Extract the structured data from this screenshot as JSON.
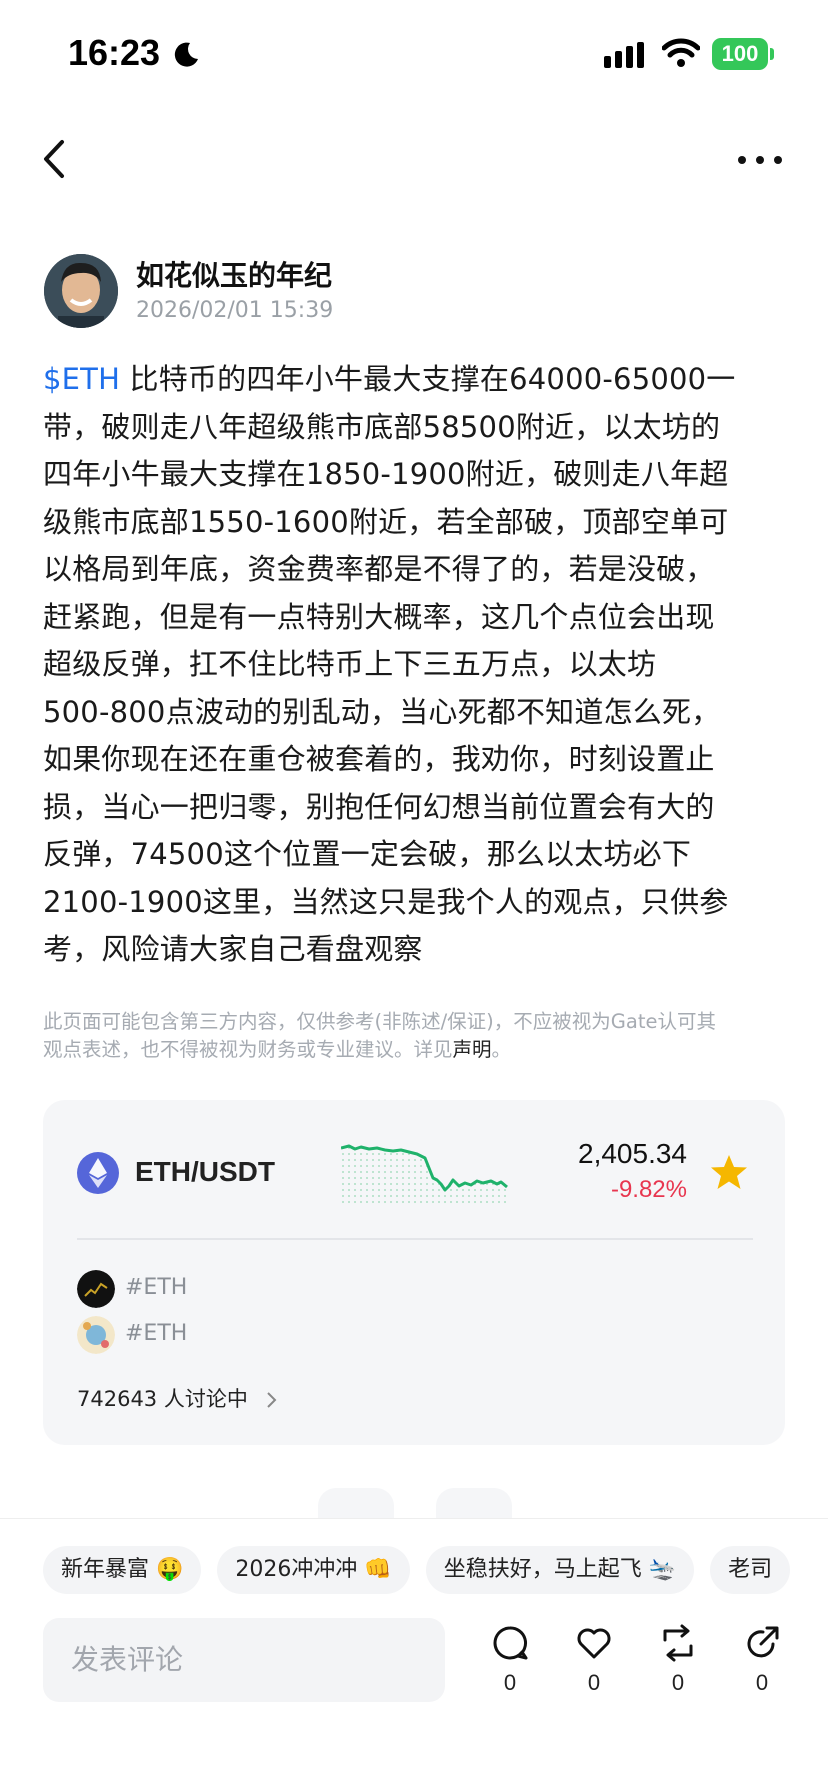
{
  "status_bar": {
    "time": "16:23",
    "battery": "100"
  },
  "author": {
    "name": "如花似玉的年纪",
    "post_time": "2026/02/01 15:39"
  },
  "post": {
    "tag": "$ETH",
    "lines": [
      " 比特币的四年小牛最大支撑在64000-65000一",
      "带，破则走八年超级熊市底部58500附近，以太坊的",
      "四年小牛最大支撑在1850-1900附近，破则走八年超",
      "级熊市底部1550-1600附近，若全部破，顶部空单可",
      "以格局到年底，资金费率都是不得了的，若是没破，",
      "赶紧跑，但是有一点特别大概率，这几个点位会出现",
      "超级反弹，扛不住比特币上下三五万点，以太坊",
      "500-800点波动的别乱动，当心死都不知道怎么死，",
      "如果你现在还在重仓被套着的，我劝你，时刻设置止",
      "损，当心一把归零，别抱任何幻想当前位置会有大的",
      "反弹，74500这个位置一定会破，那么以太坊必下",
      "2100-1900这里，当然这只是我个人的观点，只供参",
      "考，风险请大家自己看盘观察"
    ]
  },
  "disclaimer": {
    "line1": "此页面可能包含第三方内容，仅供参考(非陈述/保证)，不应被视为Gate认可其",
    "line2": "观点表述，也不得被视为财务或专业建议。详见",
    "link": "声明",
    "end": "。"
  },
  "market_card": {
    "pair": "ETH/USDT",
    "price": "2,405.34",
    "change": "-9.82%",
    "topics": [
      "#ETH",
      "#ETH"
    ],
    "discussion": "742643 人讨论中"
  },
  "chips": [
    "新年暴富 🤑",
    "2026冲冲冲 👊",
    "坐稳扶好，马上起飞 🛬",
    "老司"
  ],
  "comment": {
    "placeholder": "发表评论"
  },
  "actions": {
    "comments": "0",
    "likes": "0",
    "reposts": "0",
    "shares": "0"
  },
  "colors": {
    "accent_blue": "#1f6feb",
    "negative_red": "#e8364f",
    "chart_green": "#1fb26b",
    "star_yellow": "#f5b700"
  },
  "icons": [
    "moon-icon",
    "signal-icon",
    "wifi-icon",
    "battery-icon",
    "back-icon",
    "more-icon",
    "eth-logo-icon",
    "star-icon",
    "chevron-right-icon",
    "comment-icon",
    "heart-icon",
    "repost-icon",
    "share-icon"
  ]
}
